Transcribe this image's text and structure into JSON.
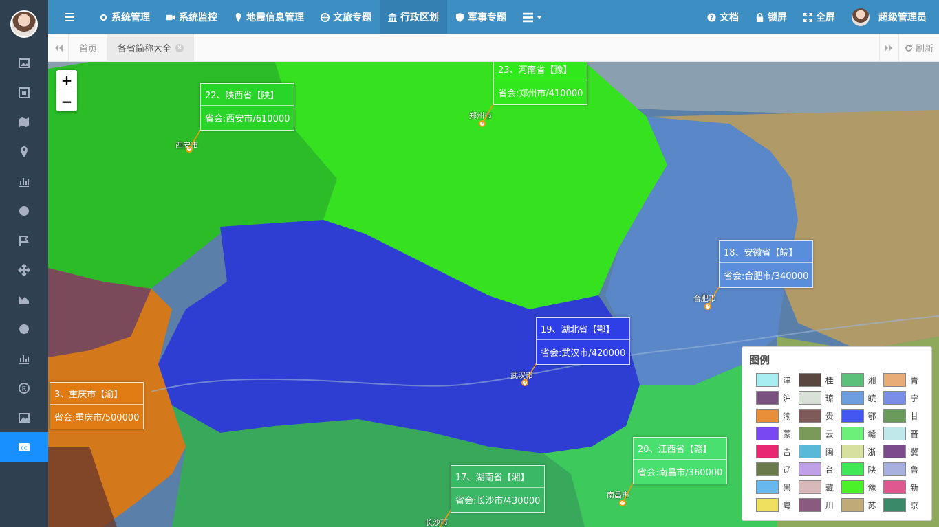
{
  "nav": {
    "items": [
      {
        "label": "系统管理"
      },
      {
        "label": "系统监控"
      },
      {
        "label": "地震信息管理"
      },
      {
        "label": "文旅专题"
      },
      {
        "label": "行政区划"
      },
      {
        "label": "军事专题"
      }
    ],
    "docs": "文档",
    "lock": "锁屏",
    "fullscreen": "全屏",
    "user": "超级管理员"
  },
  "tabs": {
    "home": "首页",
    "current": "各省简称大全",
    "refresh": "刷新"
  },
  "map": {
    "zoom_in": "+",
    "zoom_out": "−",
    "provinces": [
      {
        "title": "22、陕西省【陕】",
        "capital": "省会:西安市/610000",
        "color": "#2ecc2e"
      },
      {
        "title": "23、河南省【豫】",
        "capital": "省会:郑州市/410000",
        "color": "#33ee22"
      },
      {
        "title": "18、安徽省【皖】",
        "capital": "省会:合肥市/340000",
        "color": "#5b8fd4"
      },
      {
        "title": "19、湖北省【鄂】",
        "capital": "省会:武汉市/420000",
        "color": "#2f3fe0"
      },
      {
        "title": "3、重庆市【渝】",
        "capital": "省会:重庆市/500000",
        "color": "#e08a1e"
      },
      {
        "title": "20、江西省【赣】",
        "capital": "省会:南昌市/360000",
        "color": "#4fe07a"
      },
      {
        "title": "17、湖南省【湘】",
        "capital": "省会:长沙市/430000",
        "color": "#3fb870"
      }
    ],
    "cities": [
      "西安市",
      "郑州市",
      "合肥市",
      "武汉市",
      "南昌市",
      "长沙市"
    ]
  },
  "legend": {
    "title": "图例",
    "items": [
      {
        "label": "津",
        "color": "#a8eef0"
      },
      {
        "label": "桂",
        "color": "#5a4640"
      },
      {
        "label": "湘",
        "color": "#5cc07a"
      },
      {
        "label": "青",
        "color": "#e8ac78"
      },
      {
        "label": "沪",
        "color": "#7a5280"
      },
      {
        "label": "琼",
        "color": "#d8e0d8"
      },
      {
        "label": "皖",
        "color": "#6d9ee0"
      },
      {
        "label": "宁",
        "color": "#7a8ee8"
      },
      {
        "label": "渝",
        "color": "#e88e38"
      },
      {
        "label": "贵",
        "color": "#7e5a5a"
      },
      {
        "label": "鄂",
        "color": "#4258f0"
      },
      {
        "label": "甘",
        "color": "#6a9a5a"
      },
      {
        "label": "蒙",
        "color": "#7a48f0"
      },
      {
        "label": "云",
        "color": "#7a9a5a"
      },
      {
        "label": "赣",
        "color": "#6cf07a"
      },
      {
        "label": "晋",
        "color": "#c0e8ea"
      },
      {
        "label": "吉",
        "color": "#e82870"
      },
      {
        "label": "闽",
        "color": "#5ab8d8"
      },
      {
        "label": "浙",
        "color": "#d8e0a0"
      },
      {
        "label": "冀",
        "color": "#7a4a8a"
      },
      {
        "label": "辽",
        "color": "#6a7a4a"
      },
      {
        "label": "台",
        "color": "#c0a0e8"
      },
      {
        "label": "陕",
        "color": "#40e858"
      },
      {
        "label": "鲁",
        "color": "#a8b0e0"
      },
      {
        "label": "黑",
        "color": "#68b8f0"
      },
      {
        "label": "藏",
        "color": "#d8b8b8"
      },
      {
        "label": "豫",
        "color": "#4af028"
      },
      {
        "label": "新",
        "color": "#e05890"
      },
      {
        "label": "粤",
        "color": "#f0e060"
      },
      {
        "label": "川",
        "color": "#8a5a80"
      },
      {
        "label": "苏",
        "color": "#c0aa78"
      },
      {
        "label": "京",
        "color": "#3a8a6a"
      }
    ]
  }
}
